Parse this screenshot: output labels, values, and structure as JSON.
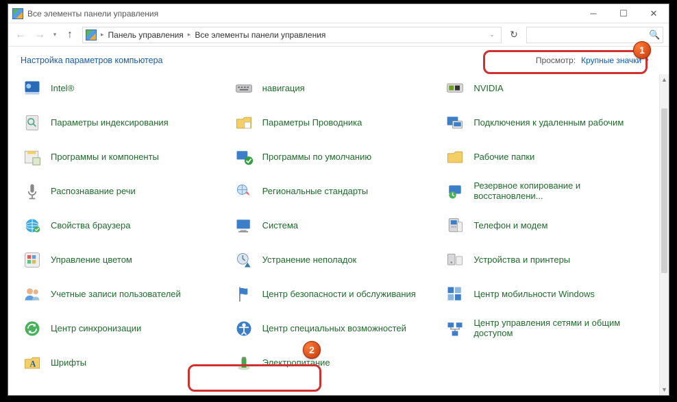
{
  "window": {
    "title": "Все элементы панели управления"
  },
  "breadcrumb": {
    "root": "Панель управления",
    "current": "Все элементы панели управления"
  },
  "search": {
    "placeholder": ""
  },
  "content": {
    "title": "Настройка параметров компьютера",
    "view_label": "Просмотр:",
    "view_mode": "Крупные значки"
  },
  "badges": {
    "one": "1",
    "two": "2"
  },
  "items": [
    {
      "label": "Intel®",
      "icon": "cpu"
    },
    {
      "label": "навигация",
      "icon": "keyboard"
    },
    {
      "label": "NVIDIA",
      "icon": "nvidia"
    },
    {
      "label": "Параметры индексирования",
      "icon": "index"
    },
    {
      "label": "Параметры Проводника",
      "icon": "folder-opt"
    },
    {
      "label": "Подключения к удаленным рабочим",
      "icon": "remote"
    },
    {
      "label": "Программы и компоненты",
      "icon": "programs"
    },
    {
      "label": "Программы по умолчанию",
      "icon": "defaults"
    },
    {
      "label": "Рабочие папки",
      "icon": "work-folders"
    },
    {
      "label": "Распознавание речи",
      "icon": "speech"
    },
    {
      "label": "Региональные стандарты",
      "icon": "region"
    },
    {
      "label": "Резервное копирование и восстановлени...",
      "icon": "backup"
    },
    {
      "label": "Свойства браузера",
      "icon": "browser"
    },
    {
      "label": "Система",
      "icon": "system"
    },
    {
      "label": "Телефон и модем",
      "icon": "phone"
    },
    {
      "label": "Управление цветом",
      "icon": "color"
    },
    {
      "label": "Устранение неполадок",
      "icon": "troubleshoot"
    },
    {
      "label": "Устройства и принтеры",
      "icon": "devices"
    },
    {
      "label": "Учетные записи пользователей",
      "icon": "users"
    },
    {
      "label": "Центр безопасности и обслуживания",
      "icon": "flag"
    },
    {
      "label": "Центр мобильности Windows",
      "icon": "mobility"
    },
    {
      "label": "Центр синхронизации",
      "icon": "sync"
    },
    {
      "label": "Центр специальных возможностей",
      "icon": "access"
    },
    {
      "label": "Центр управления сетями и общим доступом",
      "icon": "network"
    },
    {
      "label": "Шрифты",
      "icon": "fonts"
    },
    {
      "label": "Электропитание",
      "icon": "power"
    }
  ]
}
